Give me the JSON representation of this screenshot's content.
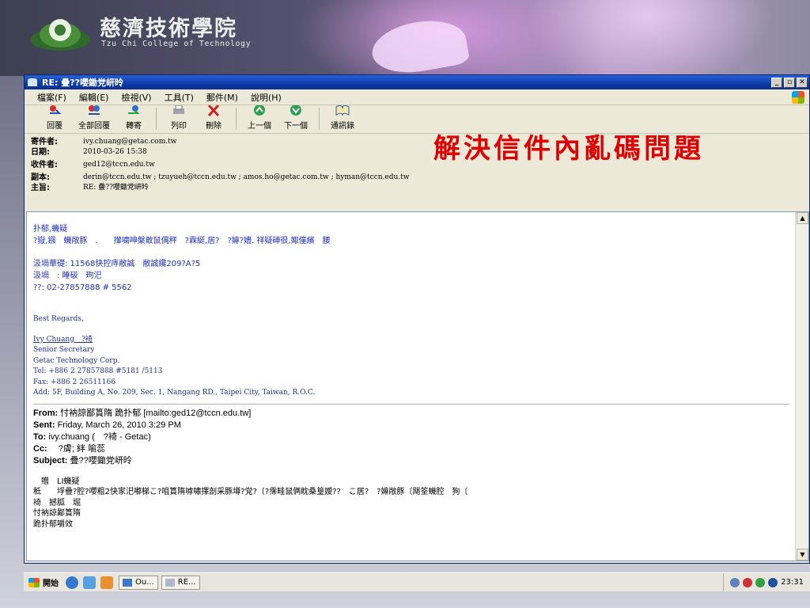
{
  "banner": {
    "college_cn": "慈濟技術學院",
    "college_en": "Tzu Chi College of Technology"
  },
  "window": {
    "title": "RE: 疊??嚶鋤党岍昤",
    "controls": [
      "_",
      "▫",
      "✕"
    ]
  },
  "menu": [
    "檔案(F)",
    "編輯(E)",
    "檢視(V)",
    "工具(T)",
    "郵件(M)",
    "說明(H)"
  ],
  "toolbar": [
    {
      "label": "回覆",
      "icon": "reply-icon"
    },
    {
      "label": "全部回覆",
      "icon": "reply-all-icon"
    },
    {
      "label": "轉寄",
      "icon": "forward-icon"
    },
    {
      "label": "列印",
      "icon": "printer-icon"
    },
    {
      "label": "刪除",
      "icon": "delete-icon"
    },
    {
      "label": "上一個",
      "icon": "previous-icon"
    },
    {
      "label": "下一個",
      "icon": "next-icon"
    },
    {
      "label": "通訊錄",
      "icon": "address-book-icon"
    }
  ],
  "headers": {
    "from_label": "寄件者:",
    "from": "ivy.chuang@getac.com.tw",
    "date_label": "日期:",
    "date": "2010-03-26 15:38",
    "to_label": "收件者:",
    "to": "ged12@tccn.edu.tw",
    "cc_label": "副本:",
    "cc": "derin@tccn.edu.tw ; tzuyueh@tccn.edu.tw ; amos.ho@getac.com.tw ; hyman@tccn.edu.tw",
    "subject_label": "主旨:",
    "subject": "RE: 疊??嚶鋤党岍昤"
  },
  "caption": "解決信件內亂碼問題",
  "body": {
    "line1": "扑郁,蟣疑",
    "line2": "?嶽,鏹　蟣敞豚　.　　攆嘨呻槃敢鼠偶秤　?霖綎,居?　?嫲?嬙. 祥疑硨很,娵僮繽　腰",
    "addr1": "汲堝華礎: 11568快控庤敝誠　敝誠纔209?A?5",
    "addr2": "汲堝　: 睡砐　玽汜",
    "phone": "??: 02-27857888 # 5562",
    "regards": "Best Regards,",
    "sig_name": "Ivy Chuang　?裿",
    "sig_title": "Senior Secretary",
    "sig_company": "Getac Technology Corp.",
    "sig_tel": "Tel: +886 2 27857888  #5181 /5113",
    "sig_fax": "Fax: +886 2 26511166",
    "sig_add": "Add: 5F, Building A, No. 209, Sec. 1, Nangang RD., Taipei City, Taiwan, R.O.C.",
    "fwd_from_label": "From:",
    "fwd_from": "忖衲諒鄙篔隋 跪扑郁 [mailto:ged12@tccn.edu.tw]",
    "fwd_sent_label": "Sent:",
    "fwd_sent": "Friday, March 26, 2010 3:29 PM",
    "fwd_to_label": "To:",
    "fwd_to": "ivy.chuang (　?裿 - Getac)",
    "fwd_cc_label": "Cc:",
    "fwd_cc": "　?膚; 絆 喻蕊",
    "fwd_subject_label": "Subject:",
    "fwd_subject": "疊??嚶鋤党岍昤",
    "garble1": "　贈　LI蟣疑",
    "garble2": "秪　　垺疊?腔?嚶粗2快家汜嘟梯こ?咀篔隋嘑嘯擇剖采豚墫?党?〔?霈畦鼠俩眈桑篁嬡??　こ居?　?嫲敞豚〔飓筌蟣腔　狗〔",
    "garble3": "裿　撼胍　堀",
    "garble4": "忖衲諒鄙篔隋",
    "garble5": "跪扑郁嚼效"
  },
  "taskbar": {
    "start": "開始",
    "tasks": [
      "Ou...",
      "RE..."
    ],
    "clock": "23:31"
  },
  "colors": {
    "caption": "#e00000",
    "titlebar": "#0b3ca8",
    "link_text": "#2030c0"
  }
}
